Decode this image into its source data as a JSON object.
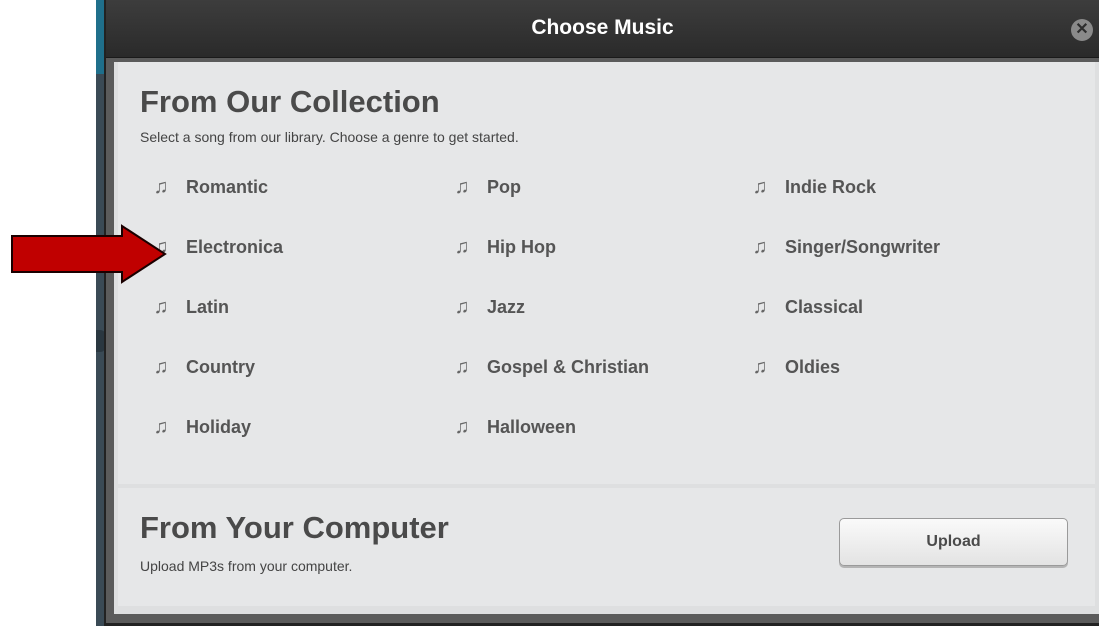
{
  "dialog": {
    "title": "Choose Music",
    "close_glyph": "✕"
  },
  "collection": {
    "title": "From Our Collection",
    "subtitle": "Select a song from our library. Choose a genre to get started.",
    "genre_icon": "music-note-icon",
    "genre_glyph": "♫",
    "genres": [
      {
        "label": "Romantic"
      },
      {
        "label": "Pop"
      },
      {
        "label": "Indie Rock"
      },
      {
        "label": "Electronica"
      },
      {
        "label": "Hip Hop"
      },
      {
        "label": "Singer/Songwriter"
      },
      {
        "label": "Latin"
      },
      {
        "label": "Jazz"
      },
      {
        "label": "Classical"
      },
      {
        "label": "Country"
      },
      {
        "label": "Gospel & Christian"
      },
      {
        "label": "Oldies"
      },
      {
        "label": "Holiday"
      },
      {
        "label": "Halloween"
      }
    ]
  },
  "computer": {
    "title": "From Your Computer",
    "subtitle": "Upload MP3s from your computer.",
    "upload_label": "Upload"
  },
  "annotation": {
    "arrow_color": "#c00000",
    "points_to": "Electronica"
  }
}
